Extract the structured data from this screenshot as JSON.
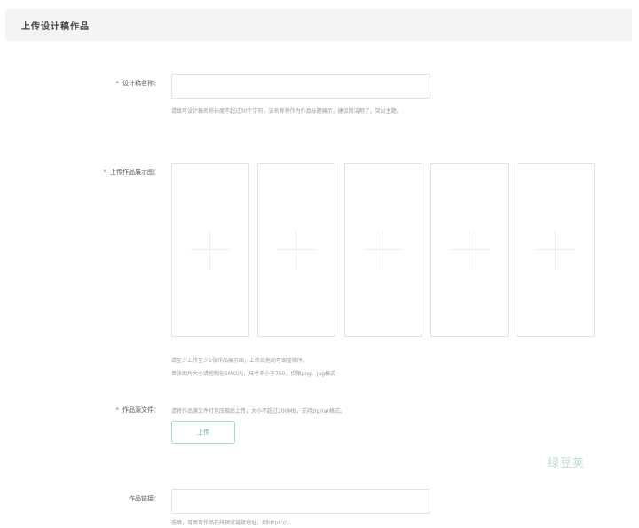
{
  "header": {
    "title": "上传设计稿作品"
  },
  "form": {
    "design_name": {
      "label": "设计稿名称：",
      "required_mark": "*",
      "value": "",
      "hint": "请填写设计稿名称长度不超过30个字符，该名称将作为作品标题展示，建议简洁明了，突出主题。"
    },
    "content_images": {
      "label": "上传作品展示图：",
      "required_mark": "*",
      "slots": [
        {
          "icon": "plus-icon"
        },
        {
          "icon": "plus-icon"
        },
        {
          "icon": "plus-icon"
        },
        {
          "icon": "plus-icon"
        },
        {
          "icon": "plus-icon"
        }
      ],
      "hint_lines": [
        "请至少上传至少1张作品展示图，上传后拖动可调整顺序。",
        "单张图片大小请控制在5M以内，尺寸不小于750，仅限png、jpg格式"
      ]
    },
    "source_file": {
      "label": "作品源文件：",
      "required_mark": "*",
      "hint": "请将作品源文件打包压缩后上传，大小不超过200MB，支持zip/rar格式。",
      "button_label": "上传"
    },
    "preview_link": {
      "label": "作品链接：",
      "value": "",
      "hint": "选填，可填写作品在线预览链接地址，如https://..."
    }
  },
  "watermark": {
    "text": "绿豆荚"
  },
  "colors": {
    "accent": "#5fb88f",
    "required": "#e0504b",
    "header_bg": "#f4f4f4"
  }
}
